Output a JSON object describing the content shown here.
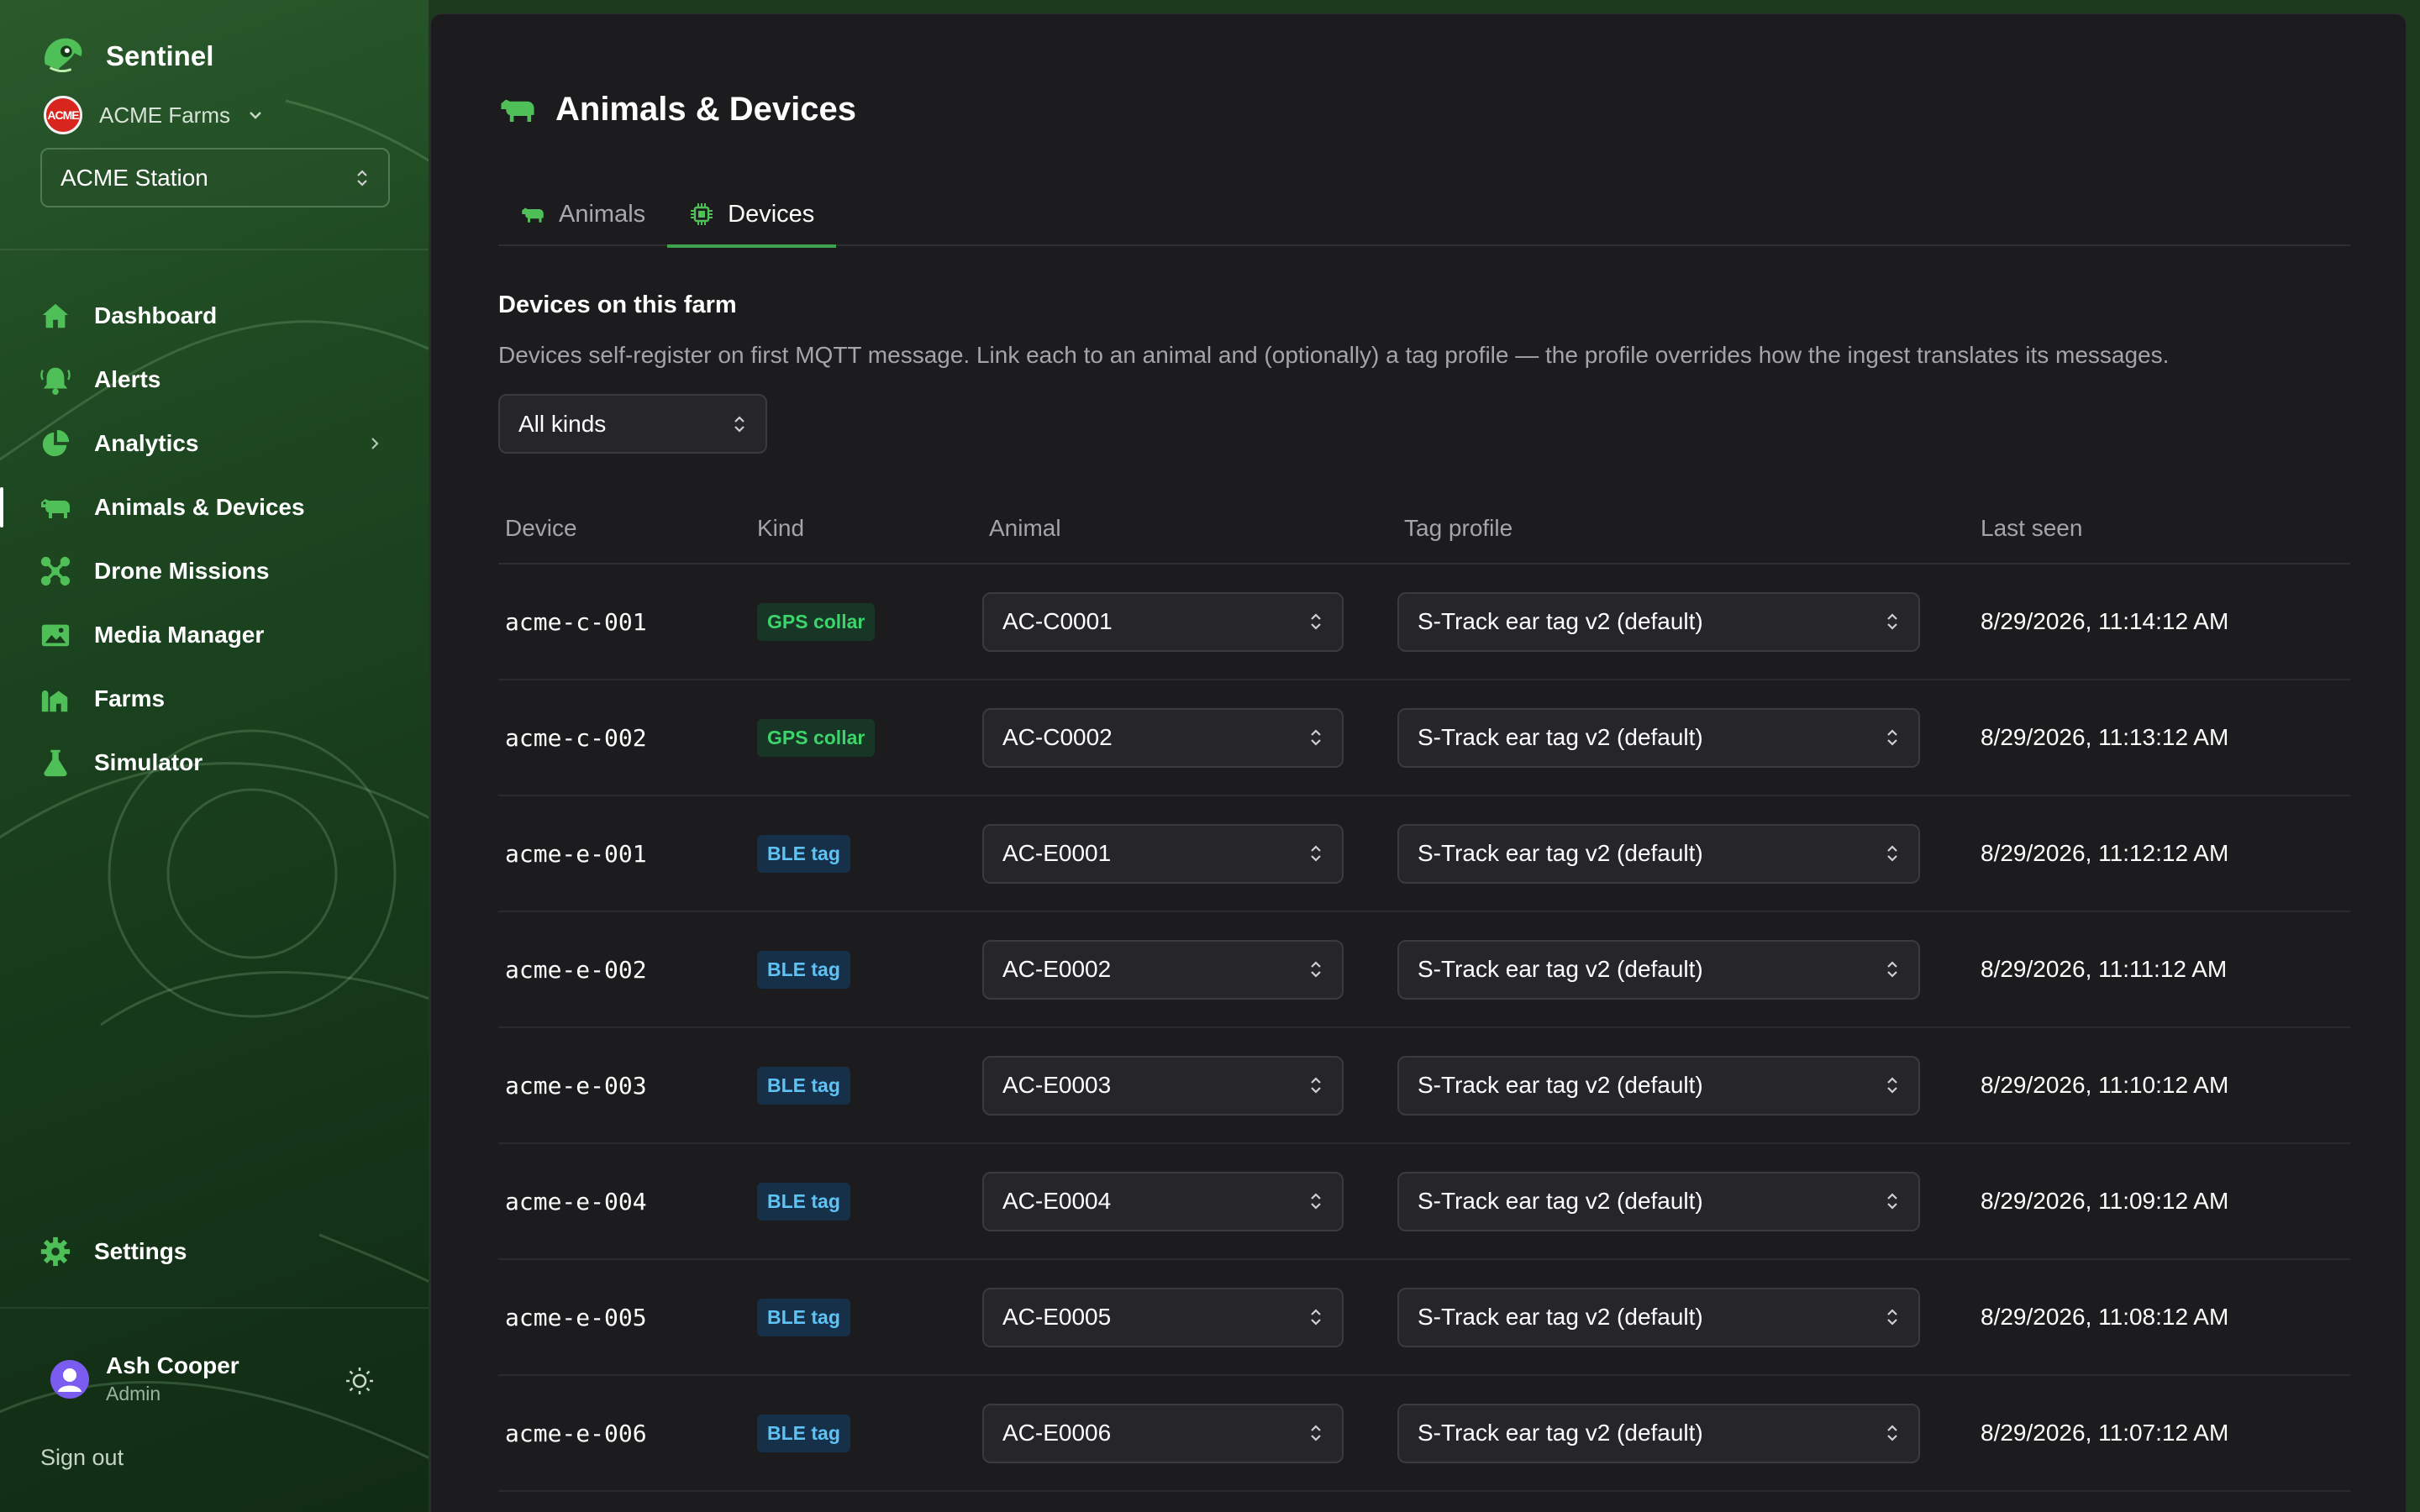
{
  "app": {
    "name": "Sentinel"
  },
  "org": {
    "name": "ACME Farms",
    "logo_text": "ACME"
  },
  "station": {
    "value": "ACME Station"
  },
  "nav": [
    {
      "label": "Dashboard",
      "icon": "home-icon"
    },
    {
      "label": "Alerts",
      "icon": "bell-icon"
    },
    {
      "label": "Analytics",
      "icon": "pie-chart-icon"
    },
    {
      "label": "Animals & Devices",
      "icon": "cow-icon"
    },
    {
      "label": "Drone Missions",
      "icon": "drone-icon"
    },
    {
      "label": "Media Manager",
      "icon": "image-icon"
    },
    {
      "label": "Farms",
      "icon": "farm-icon"
    },
    {
      "label": "Simulator",
      "icon": "flask-icon"
    }
  ],
  "settings": {
    "label": "Settings"
  },
  "user": {
    "name": "Ash Cooper",
    "role": "Admin"
  },
  "signout": "Sign out",
  "page": {
    "title": "Animals & Devices"
  },
  "tabs": [
    {
      "label": "Animals"
    },
    {
      "label": "Devices"
    }
  ],
  "section": {
    "title": "Devices on this farm",
    "description": "Devices self-register on first MQTT message. Link each to an animal and (optionally) a tag profile — the profile overrides how the ingest translates its messages."
  },
  "filter": {
    "value": "All kinds"
  },
  "table": {
    "headers": [
      "Device",
      "Kind",
      "Animal",
      "Tag profile",
      "Last seen"
    ],
    "rows": [
      {
        "device": "acme-c-001",
        "kind": "GPS collar",
        "animal": "AC-C0001",
        "profile": "S-Track ear tag v2 (default)",
        "last_seen": "8/29/2026, 11:14:12 AM"
      },
      {
        "device": "acme-c-002",
        "kind": "GPS collar",
        "animal": "AC-C0002",
        "profile": "S-Track ear tag v2 (default)",
        "last_seen": "8/29/2026, 11:13:12 AM"
      },
      {
        "device": "acme-e-001",
        "kind": "BLE tag",
        "animal": "AC-E0001",
        "profile": "S-Track ear tag v2 (default)",
        "last_seen": "8/29/2026, 11:12:12 AM"
      },
      {
        "device": "acme-e-002",
        "kind": "BLE tag",
        "animal": "AC-E0002",
        "profile": "S-Track ear tag v2 (default)",
        "last_seen": "8/29/2026, 11:11:12 AM"
      },
      {
        "device": "acme-e-003",
        "kind": "BLE tag",
        "animal": "AC-E0003",
        "profile": "S-Track ear tag v2 (default)",
        "last_seen": "8/29/2026, 11:10:12 AM"
      },
      {
        "device": "acme-e-004",
        "kind": "BLE tag",
        "animal": "AC-E0004",
        "profile": "S-Track ear tag v2 (default)",
        "last_seen": "8/29/2026, 11:09:12 AM"
      },
      {
        "device": "acme-e-005",
        "kind": "BLE tag",
        "animal": "AC-E0005",
        "profile": "S-Track ear tag v2 (default)",
        "last_seen": "8/29/2026, 11:08:12 AM"
      },
      {
        "device": "acme-e-006",
        "kind": "BLE tag",
        "animal": "AC-E0006",
        "profile": "S-Track ear tag v2 (default)",
        "last_seen": "8/29/2026, 11:07:12 AM"
      }
    ]
  },
  "colors": {
    "accent": "#3fa34d",
    "gps_badge": "#3cd46b",
    "ble_badge": "#5ec2f5",
    "sidebar": "#1f4a22",
    "surface": "#1c1c1e"
  }
}
